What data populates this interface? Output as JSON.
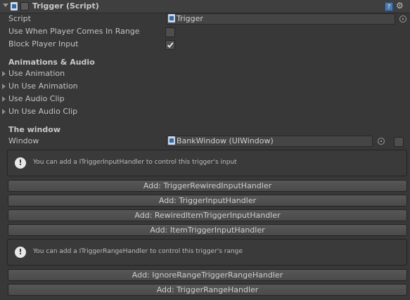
{
  "header": {
    "title": "Trigger (Script)",
    "icons": [
      "script-icon",
      "help-icon",
      "gear-icon"
    ]
  },
  "fields": {
    "script_label": "Script",
    "script_value": "Trigger",
    "use_when_label": "Use When Player Comes In Range",
    "use_when_checked": false,
    "block_label": "Block Player Input",
    "block_checked": true
  },
  "animations": {
    "heading": "Animations & Audio",
    "items": [
      "Use Animation",
      "Un Use Animation",
      "Use Audio Clip",
      "Un Use Audio Clip"
    ]
  },
  "window_section": {
    "heading": "The window",
    "window_label": "Window",
    "window_value": "BankWindow (UIWindow)",
    "window_checked": false
  },
  "input_help": {
    "text": "You can add a ITriggerInputHandler to control this trigger's input",
    "buttons": [
      "Add: TriggerRewiredInputHandler",
      "Add: TriggerInputHandler",
      "Add: RewiredItemTriggerInputHandler",
      "Add: ItemTriggerInputHandler"
    ]
  },
  "range_help": {
    "text": "You can add a ITriggerRangeHandler to control this trigger's range",
    "buttons": [
      "Add: IgnoreRangeTriggerRangeHandler",
      "Add: TriggerRangeHandler"
    ]
  }
}
